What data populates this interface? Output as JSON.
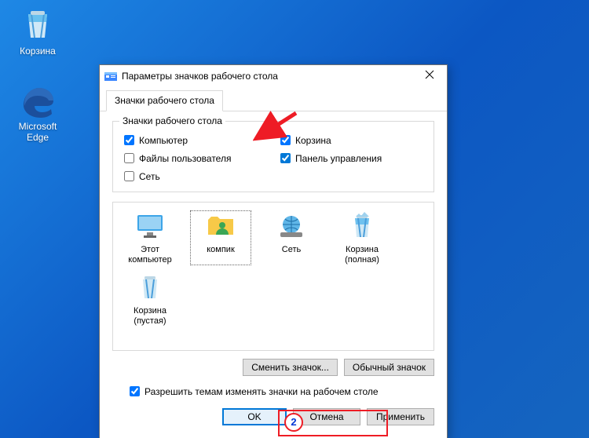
{
  "desktop": {
    "icons": [
      {
        "name": "recycle-bin",
        "label": "Корзина"
      },
      {
        "name": "edge",
        "label": "Microsoft Edge"
      }
    ]
  },
  "window": {
    "title": "Параметры значков рабочего стола",
    "tab": "Значки рабочего стола",
    "group_title": "Значки рабочего стола",
    "checkboxes": [
      {
        "key": "computer",
        "label": "Компьютер",
        "checked": true
      },
      {
        "key": "recycle",
        "label": "Корзина",
        "checked": true
      },
      {
        "key": "user_files",
        "label": "Файлы пользователя",
        "checked": false
      },
      {
        "key": "control_panel",
        "label": "Панель управления",
        "checked": true
      },
      {
        "key": "network",
        "label": "Сеть",
        "checked": false
      }
    ],
    "icons": [
      {
        "key": "this_pc",
        "label": "Этот компьютер",
        "glyph": "monitor"
      },
      {
        "key": "kompik",
        "label": "компик",
        "glyph": "folder-user",
        "selected": true
      },
      {
        "key": "network",
        "label": "Сеть",
        "glyph": "globe-net"
      },
      {
        "key": "bin_full",
        "label": "Корзина (полная)",
        "glyph": "bin-full"
      },
      {
        "key": "bin_empty",
        "label": "Корзина (пустая)",
        "glyph": "bin-empty"
      }
    ],
    "buttons": {
      "change_icon": "Сменить значок...",
      "default_icon": "Обычный значок",
      "ok": "OK",
      "cancel": "Отмена",
      "apply": "Применить"
    },
    "allow_themes": {
      "label": "Разрешить темам изменять значки на рабочем столе",
      "checked": true
    }
  },
  "annotation": {
    "step_number": "2"
  }
}
